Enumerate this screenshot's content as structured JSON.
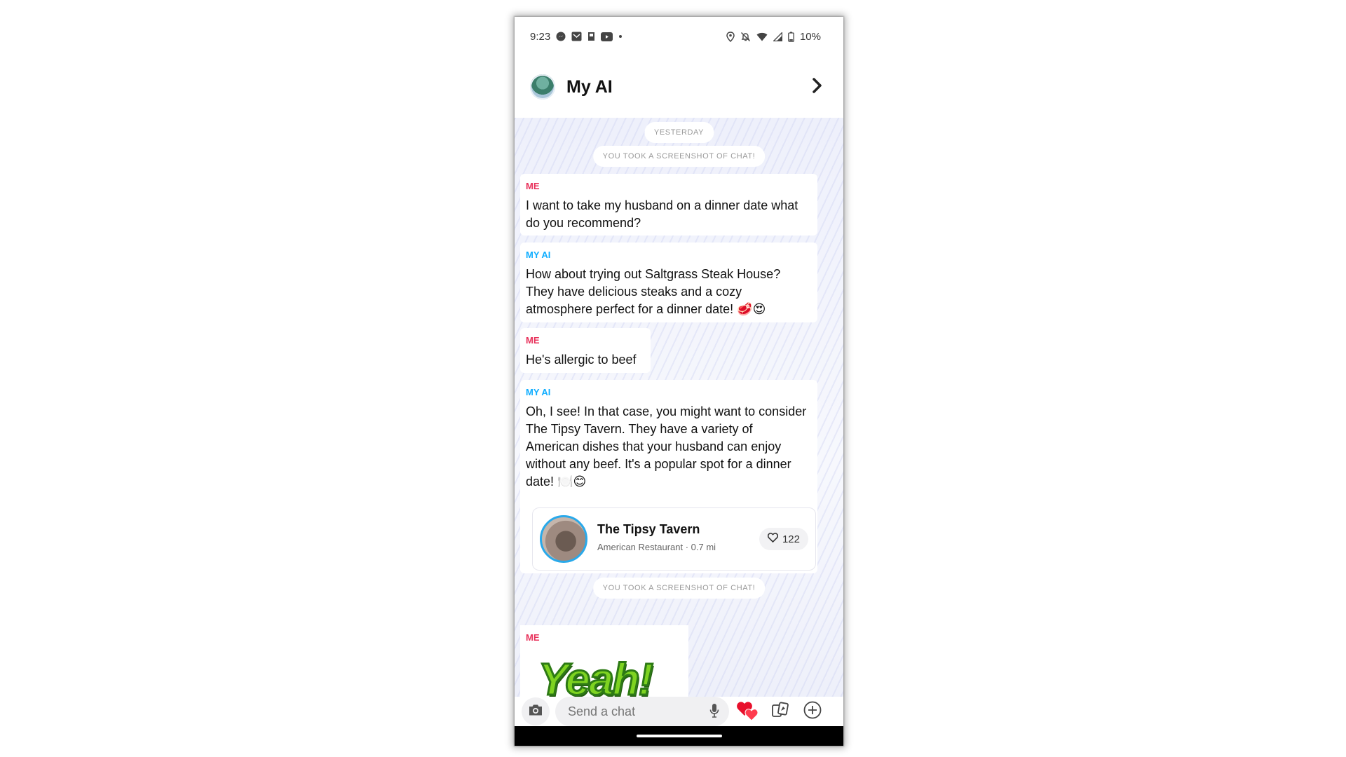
{
  "status_bar": {
    "time": "9:23",
    "battery": "10%",
    "left_icons": [
      "messenger-icon",
      "email-icon",
      "sim-icon",
      "youtube-icon",
      "dot-icon"
    ],
    "right_icons": [
      "location-icon",
      "mute-bell-icon",
      "wifi-icon",
      "signal-icon",
      "battery-icon"
    ]
  },
  "header": {
    "title": "My AI"
  },
  "chat": {
    "date_label": "YESTERDAY",
    "screenshot_notice_1": "YOU TOOK A SCREENSHOT OF CHAT!",
    "screenshot_notice_2": "YOU TOOK A SCREENSHOT OF CHAT!",
    "messages": [
      {
        "sender": "ME",
        "text": "I want to take my husband on a dinner date what do you recommend?"
      },
      {
        "sender": "MY AI",
        "text": "How about trying out Saltgrass Steak House? They have delicious steaks and a cozy atmosphere perfect for a dinner date! 🥩😍"
      },
      {
        "sender": "ME",
        "text": "He's allergic to beef"
      },
      {
        "sender": "MY AI",
        "text": "Oh, I see! In that case, you might want to consider The Tipsy Tavern. They have a variety of American dishes that your husband can enjoy without any beef. It's a popular spot for a dinner date! 🍽️😊"
      },
      {
        "sender": "ME",
        "text": ""
      }
    ],
    "place_card": {
      "name": "The Tipsy Tavern",
      "subtitle": "American Restaurant · 0.7 mi",
      "likes": "122"
    },
    "sticker_text": "Yeah!"
  },
  "composer": {
    "placeholder": "Send a chat"
  },
  "colors": {
    "me": "#e8305a",
    "my_ai": "#0eadff",
    "card_ring": "#29a9ea"
  }
}
